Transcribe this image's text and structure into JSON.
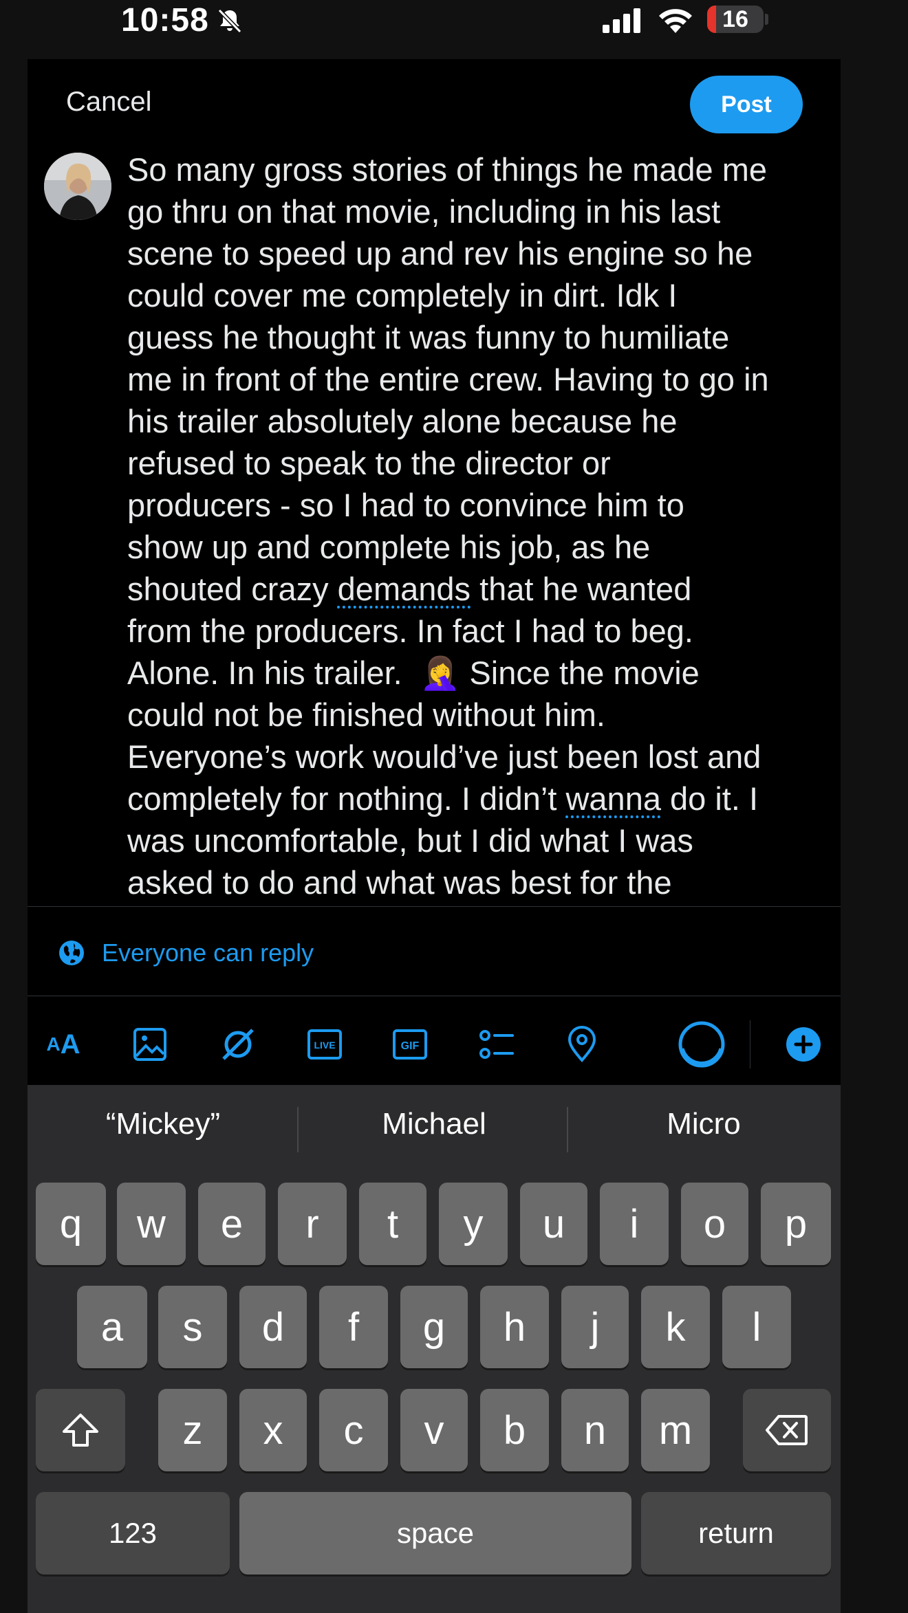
{
  "status_bar": {
    "time": "10:58",
    "battery_level": "16",
    "icons": [
      "bell-slash-icon",
      "signal-icon",
      "wifi-icon",
      "battery-icon"
    ]
  },
  "header": {
    "cancel_label": "Cancel",
    "post_label": "Post"
  },
  "compose": {
    "lines": [
      "So many gross stories of things he made me",
      "go thru on that movie, including in his last",
      "scene to speed up and rev his engine so he",
      "could cover me completely in dirt. Idk I",
      "guess he thought it was funny to humiliate",
      "me in front of the entire crew. Having to go in",
      "his trailer absolutely alone because he",
      "refused to speak to the director or",
      "producers - so I had to convince him to",
      "show up and complete his job, as he",
      "shouted crazy ",
      "demands",
      " that he wanted",
      "from the producers. In fact I had to beg.",
      "Alone. In his trailer.  ",
      "🤦‍♀️",
      " Since the movie",
      "could not be finished without him.",
      "Everyone’s work would’ve just been lost and",
      "completely for nothing. I didn’t ",
      "wanna",
      " do it. I",
      "was uncomfortable, but I did what I was",
      "asked to do and what was best for the"
    ]
  },
  "reply_setting": {
    "label": "Everyone can reply",
    "icon": "globe-icon"
  },
  "toolbar": {
    "text_format_a_small": "A",
    "text_format_a_large": "A",
    "live_label": "LIVE",
    "gif_label": "GIF",
    "icons": [
      "text-format-icon",
      "image-icon",
      "grok-icon",
      "live-icon",
      "gif-icon",
      "poll-icon",
      "location-icon",
      "character-count-icon",
      "add-post-icon"
    ]
  },
  "keyboard": {
    "suggestions": [
      "“Mickey”",
      "Michael",
      "Micro"
    ],
    "row1": [
      "q",
      "w",
      "e",
      "r",
      "t",
      "y",
      "u",
      "i",
      "o",
      "p"
    ],
    "row2": [
      "a",
      "s",
      "d",
      "f",
      "g",
      "h",
      "j",
      "k",
      "l"
    ],
    "row3": [
      "z",
      "x",
      "c",
      "v",
      "b",
      "n",
      "m"
    ],
    "numbers_label": "123",
    "space_label": "space",
    "return_label": "return"
  },
  "colors": {
    "accent": "#1d9bf0",
    "background": "#000000",
    "text": "#e7e9ea",
    "keyboard_bg": "#2c2c2e",
    "key": "#6b6b6b",
    "key_dark": "#474747"
  }
}
